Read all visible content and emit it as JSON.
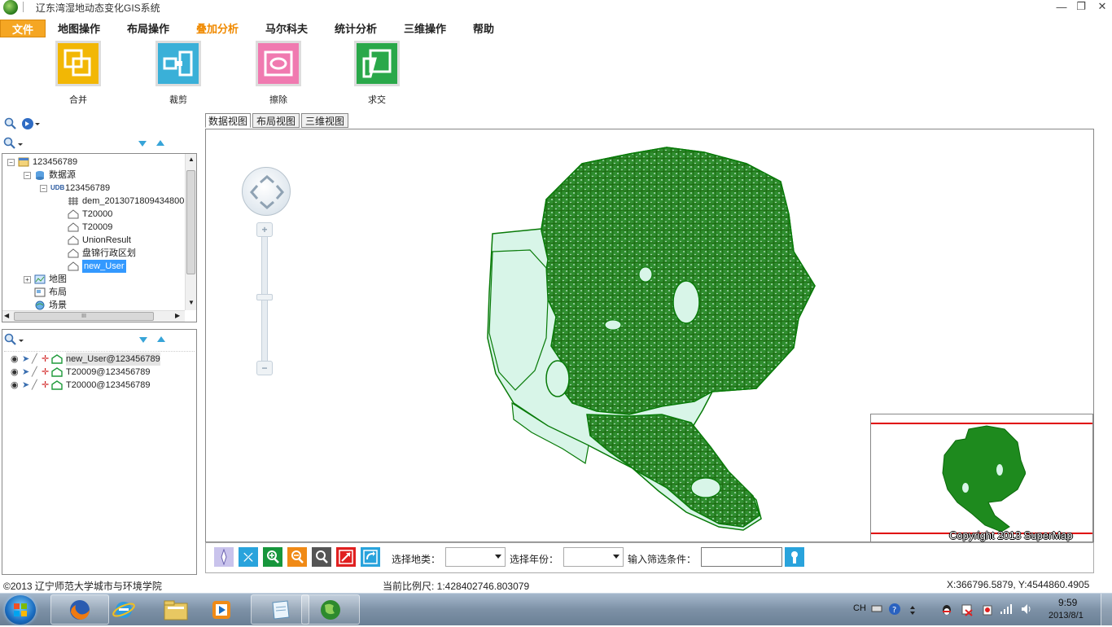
{
  "window": {
    "title": "辽东湾湿地动态变化GIS系统",
    "minimize_icon": "minimize-icon",
    "restore_icon": "restore-icon",
    "close_icon": "close-icon"
  },
  "ribbon": {
    "file_tab": "文件",
    "tabs": [
      "地图操作",
      "布局操作",
      "叠加分析",
      "马尔科夫",
      "统计分析",
      "三维操作",
      "帮助"
    ],
    "active_tab": "叠加分析",
    "buttons": [
      {
        "label": "合并",
        "icon": "union-icon",
        "color": "#f2b705"
      },
      {
        "label": "裁剪",
        "icon": "clip-icon",
        "color": "#3ab0d8"
      },
      {
        "label": "擦除",
        "icon": "erase-icon",
        "color": "#f07ab0"
      },
      {
        "label": "求交",
        "icon": "intersect-icon",
        "color": "#2aa84a"
      }
    ]
  },
  "workspace_tree": {
    "root": "123456789",
    "datasources_label": "数据源",
    "datasource": {
      "badge": "UDB",
      "name": "123456789"
    },
    "datasets": [
      "dem_2013071809434800",
      "T20000",
      "T20009",
      "UnionResult",
      "盘锦行政区划",
      "new_User"
    ],
    "selected_dataset": "new_User",
    "maps_label": "地图",
    "layouts_label": "布局",
    "scenes_label": "场景",
    "hscroll_grip": "III"
  },
  "layers": [
    "new_User@123456789",
    "T20009@123456789",
    "T20000@123456789"
  ],
  "map_tabs": [
    "数据视图",
    "布局视图",
    "三维视图"
  ],
  "active_map_tab": "数据视图",
  "map": {
    "fill_color": "#d8f5e8",
    "stroke_color": "#087a08",
    "copyright": "Copyright 2013 SuperMap"
  },
  "query_bar": {
    "land_type_label": "选择地类：",
    "land_type_value": "",
    "year_label": "选择年份：",
    "year_value": "",
    "filter_label": "输入筛选条件：",
    "filter_value": ""
  },
  "status": {
    "copyright": "©2013 辽宁师范大学城市与环境学院",
    "scale": "当前比例尺: 1:428402746.803079",
    "coords": "X:366796.5879,  Y:4544860.4905"
  },
  "taskbar": {
    "lang": "CH",
    "time": "9:59",
    "date": "2013/8/1"
  }
}
